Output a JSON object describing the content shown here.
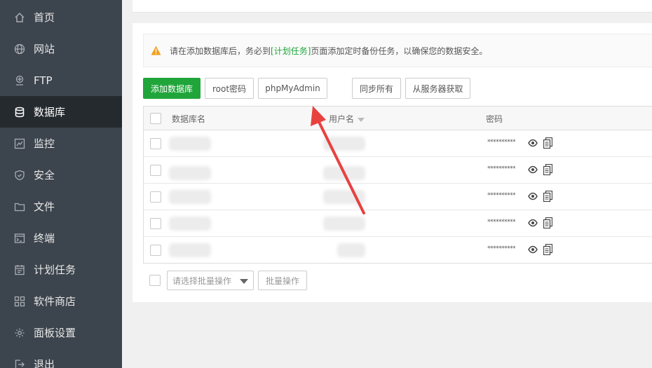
{
  "sidebar": {
    "items": [
      {
        "label": "首页",
        "icon": "home-icon"
      },
      {
        "label": "网站",
        "icon": "globe-icon"
      },
      {
        "label": "FTP",
        "icon": "ftp-icon"
      },
      {
        "label": "数据库",
        "icon": "database-icon",
        "active": true
      },
      {
        "label": "监控",
        "icon": "monitor-icon"
      },
      {
        "label": "安全",
        "icon": "shield-icon"
      },
      {
        "label": "文件",
        "icon": "folder-icon"
      },
      {
        "label": "终端",
        "icon": "terminal-icon"
      },
      {
        "label": "计划任务",
        "icon": "calendar-icon"
      },
      {
        "label": "软件商店",
        "icon": "apps-icon"
      },
      {
        "label": "面板设置",
        "icon": "gear-icon"
      },
      {
        "label": "退出",
        "icon": "logout-icon"
      }
    ]
  },
  "notice": {
    "text_before": "请在添加数据库后，务必到",
    "link": "[计划任务]",
    "text_after": "页面添加定时备份任务，以确保您的数据安全。"
  },
  "toolbar": {
    "add_db": "添加数据库",
    "root_pwd": "root密码",
    "phpmyadmin": "phpMyAdmin",
    "sync_all": "同步所有",
    "fetch_server": "从服务器获取"
  },
  "table": {
    "headers": {
      "name": "数据库名",
      "user": "用户名",
      "password": "密码"
    },
    "rows": [
      {
        "password": "**********"
      },
      {
        "password": "**********"
      },
      {
        "password": "**********"
      },
      {
        "password": "**********"
      },
      {
        "password": "**********"
      }
    ]
  },
  "batch": {
    "placeholder": "请选择批量操作",
    "button": "批量操作"
  },
  "colors": {
    "sidebar_bg": "#3c444d",
    "sidebar_active": "#252a2f",
    "accent": "#20a53a",
    "arrow": "#e8423f",
    "warning": "#f0a020"
  }
}
